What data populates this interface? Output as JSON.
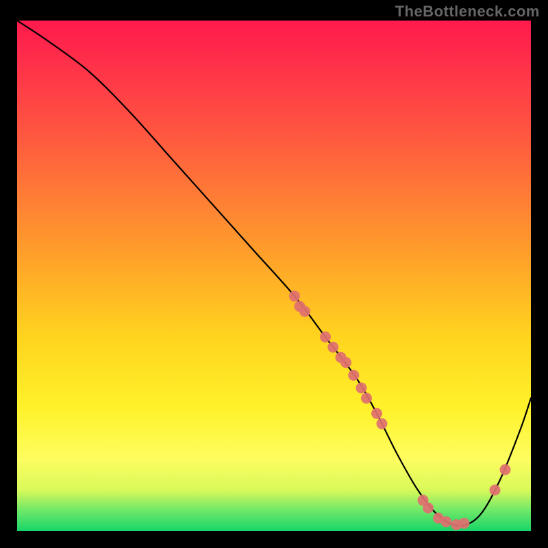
{
  "watermark": "TheBottleneck.com",
  "chart_data": {
    "type": "line",
    "title": "",
    "xlabel": "",
    "ylabel": "",
    "xlim": [
      0,
      100
    ],
    "ylim": [
      0,
      100
    ],
    "curve": {
      "x": [
        0,
        6,
        14,
        22,
        30,
        38,
        46,
        54,
        60,
        66,
        70,
        74,
        78,
        82,
        86,
        90,
        94,
        98,
        100
      ],
      "y": [
        100,
        96,
        90,
        82,
        73,
        64,
        55,
        46,
        38,
        30,
        23,
        15,
        8,
        3,
        1,
        3,
        10,
        20,
        26
      ]
    },
    "points": [
      {
        "x": 54,
        "y": 46
      },
      {
        "x": 55,
        "y": 44
      },
      {
        "x": 56,
        "y": 43
      },
      {
        "x": 60,
        "y": 38
      },
      {
        "x": 61.5,
        "y": 36
      },
      {
        "x": 63,
        "y": 34
      },
      {
        "x": 64,
        "y": 33
      },
      {
        "x": 65.5,
        "y": 30.5
      },
      {
        "x": 67,
        "y": 28
      },
      {
        "x": 68,
        "y": 26
      },
      {
        "x": 70,
        "y": 23
      },
      {
        "x": 71,
        "y": 21
      },
      {
        "x": 79,
        "y": 6
      },
      {
        "x": 80,
        "y": 4.5
      },
      {
        "x": 82,
        "y": 2.5
      },
      {
        "x": 83.5,
        "y": 1.8
      },
      {
        "x": 85.5,
        "y": 1.2
      },
      {
        "x": 87,
        "y": 1.5
      },
      {
        "x": 93,
        "y": 8
      },
      {
        "x": 95,
        "y": 12
      }
    ],
    "gradient": [
      "#ff1a4d",
      "#ff5640",
      "#ffa02a",
      "#fff22a",
      "#6ee868",
      "#18d568"
    ]
  }
}
